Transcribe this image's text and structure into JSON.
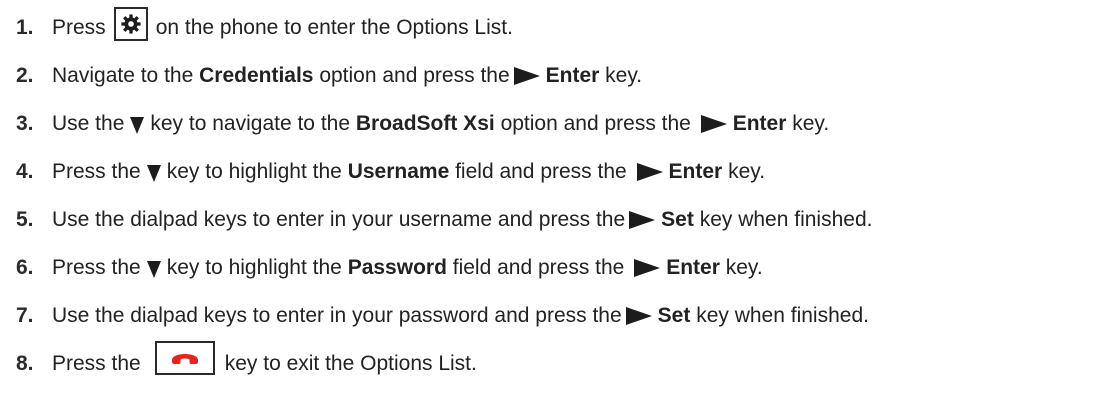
{
  "steps": [
    {
      "number": "1.",
      "text_before_icon": "Press",
      "icon": "gear-icon",
      "text_after_icon": "on the phone to enter the Options List."
    },
    {
      "number": "2.",
      "t1": "Navigate to the",
      "b1": "Credentials",
      "t2": "option and press the",
      "icon": "arrow-right-icon",
      "b2": "Enter",
      "t3": "key."
    },
    {
      "number": "3.",
      "t1": "Use the",
      "icon1": "arrow-down-icon",
      "t2": "key to navigate to the",
      "b1": "BroadSoft Xsi",
      "t3": "option and press the",
      "icon2": "arrow-right-icon",
      "b2": "Enter",
      "t4": "key."
    },
    {
      "number": "4.",
      "t1": "Press the",
      "icon1": "arrow-down-icon",
      "t2": "key to highlight the",
      "b1": "Username",
      "t3": "field and press the",
      "icon2": "arrow-right-icon",
      "b2": "Enter",
      "t4": "key."
    },
    {
      "number": "5.",
      "t1": "Use the dialpad keys to enter in your username and press the",
      "icon": "arrow-right-icon",
      "b1": "Set",
      "t2": "key when finished."
    },
    {
      "number": "6.",
      "t1": "Press the",
      "icon1": "arrow-down-icon",
      "t2": "key to highlight the",
      "b1": "Password",
      "t3": "field and press the",
      "icon2": "arrow-right-icon",
      "b2": "Enter",
      "t4": "key."
    },
    {
      "number": "7.",
      "t1": "Use the dialpad keys to enter in your password and press the",
      "icon": "arrow-right-icon",
      "b1": "Set",
      "t2": "key when finished."
    },
    {
      "number": "8.",
      "text_before_icon": "Press the",
      "icon": "end-call-icon",
      "text_after_icon": "key to exit the Options List."
    }
  ],
  "colors": {
    "text": "#222222",
    "icon": "#1c1c1c",
    "end_call_red": "#e8231f"
  }
}
